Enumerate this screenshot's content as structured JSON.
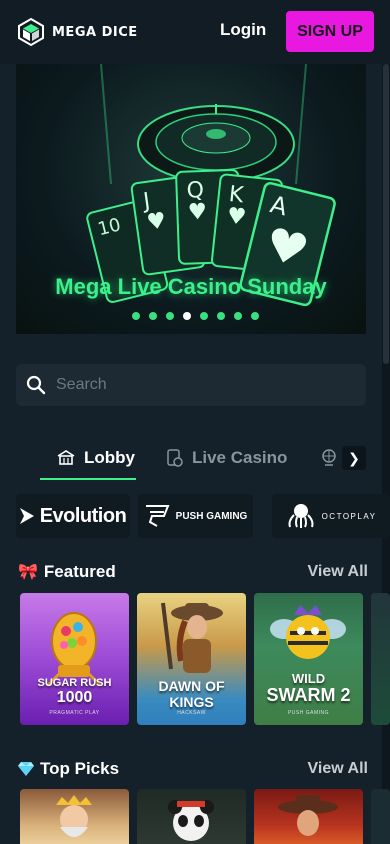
{
  "header": {
    "logo_text": "MEGA DICE",
    "login_label": "Login",
    "signup_label": "SIGN UP",
    "signup_color": "#e918e0"
  },
  "hero": {
    "title": "Mega Live Casino Sunday",
    "card_ranks": [
      "J",
      "Q",
      "K",
      "A"
    ],
    "dot_count": 8,
    "active_dot": 3
  },
  "search": {
    "placeholder": "Search",
    "icon": "search-icon"
  },
  "tabs": [
    {
      "label": "Lobby",
      "icon": "lobby-icon",
      "active": true
    },
    {
      "label": "Live Casino",
      "icon": "live-casino-icon",
      "active": false
    },
    {
      "label": "",
      "icon": "ferris-wheel-icon",
      "active": false
    }
  ],
  "providers": [
    "Evolution",
    "PUSH GAMING",
    "OCTOPLAY"
  ],
  "sections": {
    "featured": {
      "title": "Featured",
      "view_all": "View All",
      "icon": "ribbon-icon",
      "games": [
        {
          "name_line1": "SUGAR RUSH",
          "name_line2": "1000",
          "studio": "PRAGMATIC PLAY"
        },
        {
          "name_line1": "DAWN OF KINGS",
          "name_line2": "",
          "studio": "HACKSAW"
        },
        {
          "name_line1": "WILD",
          "name_line2": "SWARM 2",
          "studio": "PUSH GAMING"
        }
      ]
    },
    "top_picks": {
      "title": "Top Picks",
      "view_all": "View All",
      "icon": "diamond-icon"
    }
  },
  "colors": {
    "background": "#14212b",
    "accent_green": "#3ef08b",
    "header_bg": "#111c24"
  }
}
